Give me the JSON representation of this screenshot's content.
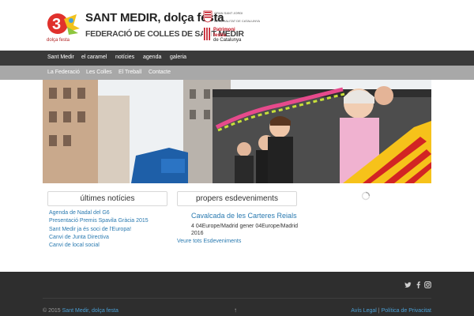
{
  "header": {
    "logo_caption": "dolça festa",
    "title": "SANT MEDIR, dolça festa",
    "subtitle": "FEDERACIÓ DE COLLES DE SANT MEDIR",
    "partner1_line1": "GRAN SANT JORDI",
    "partner1_line2": "2016",
    "partner1_line3": "GENERALITAT DE CATALUNYA",
    "partner2_line1": "Patrimoni",
    "partner2_line2": "festiu",
    "partner2_line3": "de Catalunya"
  },
  "nav_primary": [
    "Sant Medir",
    "el caramel",
    "notícies",
    "agenda",
    "galeria"
  ],
  "nav_secondary": [
    "La Federació",
    "Les Colles",
    "El Treball",
    "Contacte"
  ],
  "news": {
    "title": "últimes notícies",
    "items": [
      "Agenda de Nadal del G6",
      "Presentació Premis Spavila Gràcia 2015",
      "Sant Medir ja és soci de l'Europa!",
      "Canvi de Junta Directiva",
      "Canvi de local social"
    ]
  },
  "events": {
    "title": "propers esdeveniments",
    "event_title": "Cavalcada de les Carteres Reials",
    "event_date": "4 04Europe/Madrid gener 04Europe/Madrid 2016",
    "all_link": "Veure tots Esdeveniments"
  },
  "footer": {
    "copyright_prefix": "© 2015",
    "copyright_link": "Sant Medir, dolça festa",
    "to_top": "↑",
    "legal": "Avís Legal",
    "separator": "|",
    "privacy": "Política de Privacitat",
    "social": [
      "twitter-icon",
      "facebook-icon",
      "instagram-icon"
    ]
  },
  "colors": {
    "nav_primary_bg": "#3a3a3a",
    "nav_secondary_bg": "#a8a8a8",
    "link": "#2a7ab0",
    "footer_bg": "#2e2e2e"
  }
}
